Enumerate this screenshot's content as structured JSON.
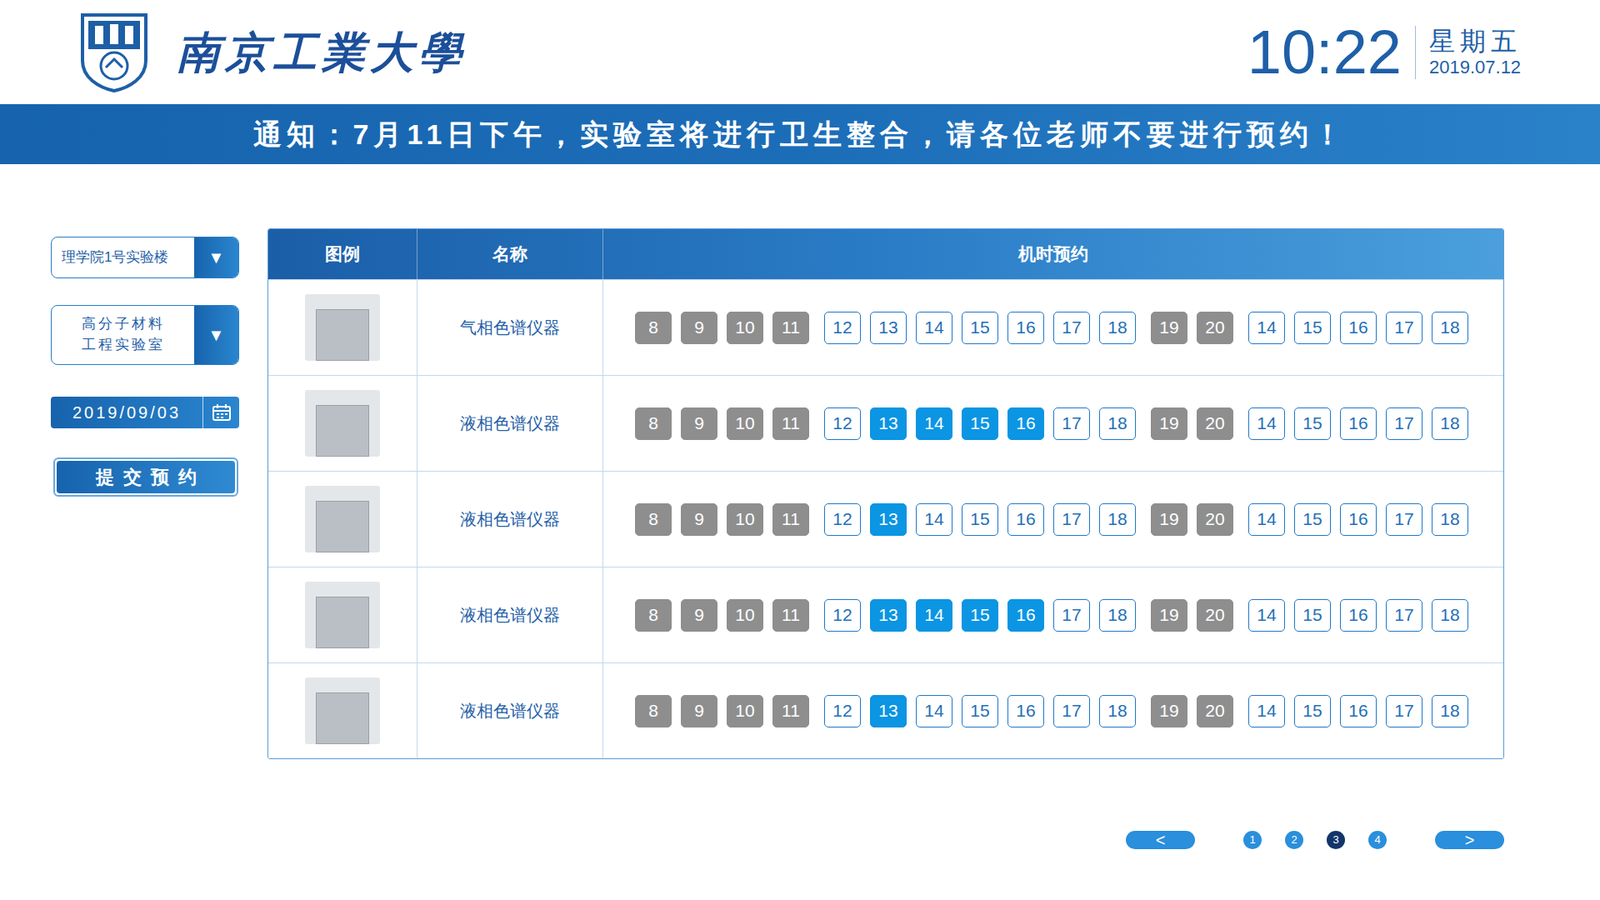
{
  "header": {
    "school_name": "南京工業大學",
    "time": "10:22",
    "weekday": "星期五",
    "date": "2019.07.12"
  },
  "notice": "通知：7月11日下午，实验室将进行卫生整合，请各位老师不要进行预约！",
  "filters": {
    "building": {
      "value": "理学院1号实验楼",
      "icon": "▼"
    },
    "lab": {
      "value": "高分子材料工程实验室",
      "icon": "▼"
    },
    "date": "2019/09/03",
    "submit": "提交预约"
  },
  "table": {
    "columns": [
      "图例",
      "名称",
      "机时预约"
    ],
    "rows": [
      {
        "name": "气相色谱仪器",
        "slots": [
          {
            "label": "8",
            "disabled": true,
            "selected": false
          },
          {
            "label": "9",
            "disabled": true,
            "selected": false
          },
          {
            "label": "10",
            "disabled": true,
            "selected": false
          },
          {
            "label": "11",
            "disabled": true,
            "selected": false
          },
          {
            "label": "12",
            "disabled": false,
            "selected": false
          },
          {
            "label": "13",
            "disabled": false,
            "selected": false
          },
          {
            "label": "14",
            "disabled": false,
            "selected": false
          },
          {
            "label": "15",
            "disabled": false,
            "selected": false
          },
          {
            "label": "16",
            "disabled": false,
            "selected": false
          },
          {
            "label": "17",
            "disabled": false,
            "selected": false
          },
          {
            "label": "18",
            "disabled": false,
            "selected": false
          },
          {
            "label": "19",
            "disabled": true,
            "selected": false
          },
          {
            "label": "20",
            "disabled": true,
            "selected": false
          },
          {
            "label": "14",
            "disabled": false,
            "selected": false
          },
          {
            "label": "15",
            "disabled": false,
            "selected": false
          },
          {
            "label": "16",
            "disabled": false,
            "selected": false
          },
          {
            "label": "17",
            "disabled": false,
            "selected": false
          },
          {
            "label": "18",
            "disabled": false,
            "selected": false
          }
        ]
      },
      {
        "name": "液相色谱仪器",
        "slots": [
          {
            "label": "8",
            "disabled": true,
            "selected": false
          },
          {
            "label": "9",
            "disabled": true,
            "selected": false
          },
          {
            "label": "10",
            "disabled": true,
            "selected": false
          },
          {
            "label": "11",
            "disabled": true,
            "selected": false
          },
          {
            "label": "12",
            "disabled": false,
            "selected": false
          },
          {
            "label": "13",
            "disabled": false,
            "selected": true
          },
          {
            "label": "14",
            "disabled": false,
            "selected": true
          },
          {
            "label": "15",
            "disabled": false,
            "selected": true
          },
          {
            "label": "16",
            "disabled": false,
            "selected": true
          },
          {
            "label": "17",
            "disabled": false,
            "selected": false
          },
          {
            "label": "18",
            "disabled": false,
            "selected": false
          },
          {
            "label": "19",
            "disabled": true,
            "selected": false
          },
          {
            "label": "20",
            "disabled": true,
            "selected": false
          },
          {
            "label": "14",
            "disabled": false,
            "selected": false
          },
          {
            "label": "15",
            "disabled": false,
            "selected": false
          },
          {
            "label": "16",
            "disabled": false,
            "selected": false
          },
          {
            "label": "17",
            "disabled": false,
            "selected": false
          },
          {
            "label": "18",
            "disabled": false,
            "selected": false
          }
        ]
      },
      {
        "name": "液相色谱仪器",
        "slots": [
          {
            "label": "8",
            "disabled": true,
            "selected": false
          },
          {
            "label": "9",
            "disabled": true,
            "selected": false
          },
          {
            "label": "10",
            "disabled": true,
            "selected": false
          },
          {
            "label": "11",
            "disabled": true,
            "selected": false
          },
          {
            "label": "12",
            "disabled": false,
            "selected": false
          },
          {
            "label": "13",
            "disabled": false,
            "selected": true
          },
          {
            "label": "14",
            "disabled": false,
            "selected": false
          },
          {
            "label": "15",
            "disabled": false,
            "selected": false
          },
          {
            "label": "16",
            "disabled": false,
            "selected": false
          },
          {
            "label": "17",
            "disabled": false,
            "selected": false
          },
          {
            "label": "18",
            "disabled": false,
            "selected": false
          },
          {
            "label": "19",
            "disabled": true,
            "selected": false
          },
          {
            "label": "20",
            "disabled": true,
            "selected": false
          },
          {
            "label": "14",
            "disabled": false,
            "selected": false
          },
          {
            "label": "15",
            "disabled": false,
            "selected": false
          },
          {
            "label": "16",
            "disabled": false,
            "selected": false
          },
          {
            "label": "17",
            "disabled": false,
            "selected": false
          },
          {
            "label": "18",
            "disabled": false,
            "selected": false
          }
        ]
      },
      {
        "name": "液相色谱仪器",
        "slots": [
          {
            "label": "8",
            "disabled": true,
            "selected": false
          },
          {
            "label": "9",
            "disabled": true,
            "selected": false
          },
          {
            "label": "10",
            "disabled": true,
            "selected": false
          },
          {
            "label": "11",
            "disabled": true,
            "selected": false
          },
          {
            "label": "12",
            "disabled": false,
            "selected": false
          },
          {
            "label": "13",
            "disabled": false,
            "selected": true
          },
          {
            "label": "14",
            "disabled": false,
            "selected": true
          },
          {
            "label": "15",
            "disabled": false,
            "selected": true
          },
          {
            "label": "16",
            "disabled": false,
            "selected": true
          },
          {
            "label": "17",
            "disabled": false,
            "selected": false
          },
          {
            "label": "18",
            "disabled": false,
            "selected": false
          },
          {
            "label": "19",
            "disabled": true,
            "selected": false
          },
          {
            "label": "20",
            "disabled": true,
            "selected": false
          },
          {
            "label": "14",
            "disabled": false,
            "selected": false
          },
          {
            "label": "15",
            "disabled": false,
            "selected": false
          },
          {
            "label": "16",
            "disabled": false,
            "selected": false
          },
          {
            "label": "17",
            "disabled": false,
            "selected": false
          },
          {
            "label": "18",
            "disabled": false,
            "selected": false
          }
        ]
      },
      {
        "name": "液相色谱仪器",
        "slots": [
          {
            "label": "8",
            "disabled": true,
            "selected": false
          },
          {
            "label": "9",
            "disabled": true,
            "selected": false
          },
          {
            "label": "10",
            "disabled": true,
            "selected": false
          },
          {
            "label": "11",
            "disabled": true,
            "selected": false
          },
          {
            "label": "12",
            "disabled": false,
            "selected": false
          },
          {
            "label": "13",
            "disabled": false,
            "selected": true
          },
          {
            "label": "14",
            "disabled": false,
            "selected": false
          },
          {
            "label": "15",
            "disabled": false,
            "selected": false
          },
          {
            "label": "16",
            "disabled": false,
            "selected": false
          },
          {
            "label": "17",
            "disabled": false,
            "selected": false
          },
          {
            "label": "18",
            "disabled": false,
            "selected": false
          },
          {
            "label": "19",
            "disabled": true,
            "selected": false
          },
          {
            "label": "20",
            "disabled": true,
            "selected": false
          },
          {
            "label": "14",
            "disabled": false,
            "selected": false
          },
          {
            "label": "15",
            "disabled": false,
            "selected": false
          },
          {
            "label": "16",
            "disabled": false,
            "selected": false
          },
          {
            "label": "17",
            "disabled": false,
            "selected": false
          },
          {
            "label": "18",
            "disabled": false,
            "selected": false
          }
        ]
      }
    ]
  },
  "pagination": {
    "prev": "<",
    "next": ">",
    "pages": [
      {
        "label": "1",
        "selected": false
      },
      {
        "label": "2",
        "selected": false
      },
      {
        "label": "3",
        "selected": true
      },
      {
        "label": "4",
        "selected": false
      }
    ]
  }
}
